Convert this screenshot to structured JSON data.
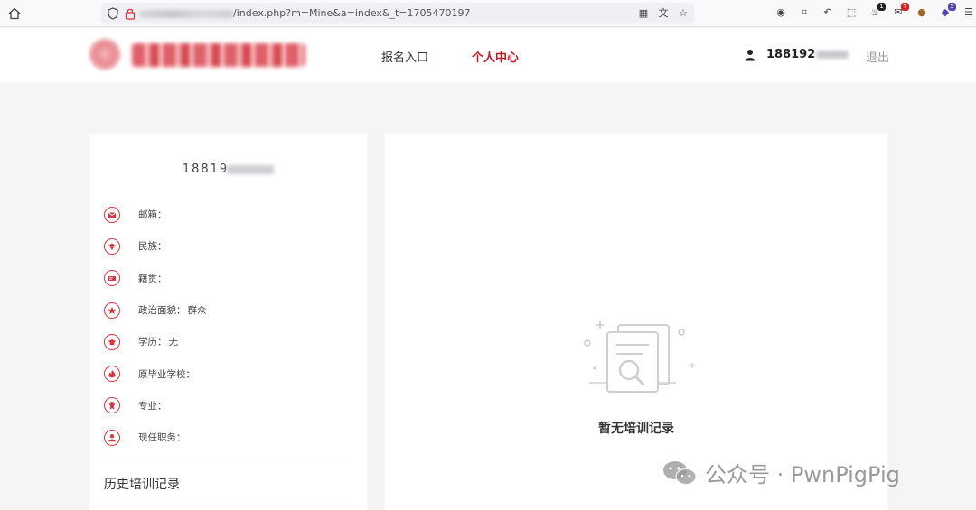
{
  "browser": {
    "url_visible": "/index.php?m=Mine&a=index&_t=1705470197",
    "extension_badges": [
      "1",
      "7",
      "5"
    ]
  },
  "header": {
    "nav": [
      {
        "label": "报名入口",
        "active": false
      },
      {
        "label": "个人中心",
        "active": true
      }
    ],
    "user_name": "188192",
    "logout_label": "退出"
  },
  "profile": {
    "id": "18819",
    "fields": [
      {
        "icon": "email-icon",
        "label": "邮箱：",
        "value": ""
      },
      {
        "icon": "ethnicity-icon",
        "label": "民族：",
        "value": ""
      },
      {
        "icon": "hometown-icon",
        "label": "籍贯：",
        "value": ""
      },
      {
        "icon": "party-icon",
        "label": "政治面貌：",
        "value": "群众"
      },
      {
        "icon": "graduation-cap-icon",
        "label": "学历：",
        "value": "无"
      },
      {
        "icon": "school-icon",
        "label": "原毕业学校：",
        "value": ""
      },
      {
        "icon": "major-icon",
        "label": "专业：",
        "value": ""
      },
      {
        "icon": "position-icon",
        "label": "现任职务：",
        "value": ""
      }
    ],
    "history_title": "历史培训记录"
  },
  "main": {
    "empty_text": "暂无培训记录"
  },
  "watermark": {
    "text": "公众号 · PwnPigPig"
  },
  "colors": {
    "brand_red": "#c8161e",
    "icon_red": "#d9373f",
    "background": "#f5f5f5"
  }
}
